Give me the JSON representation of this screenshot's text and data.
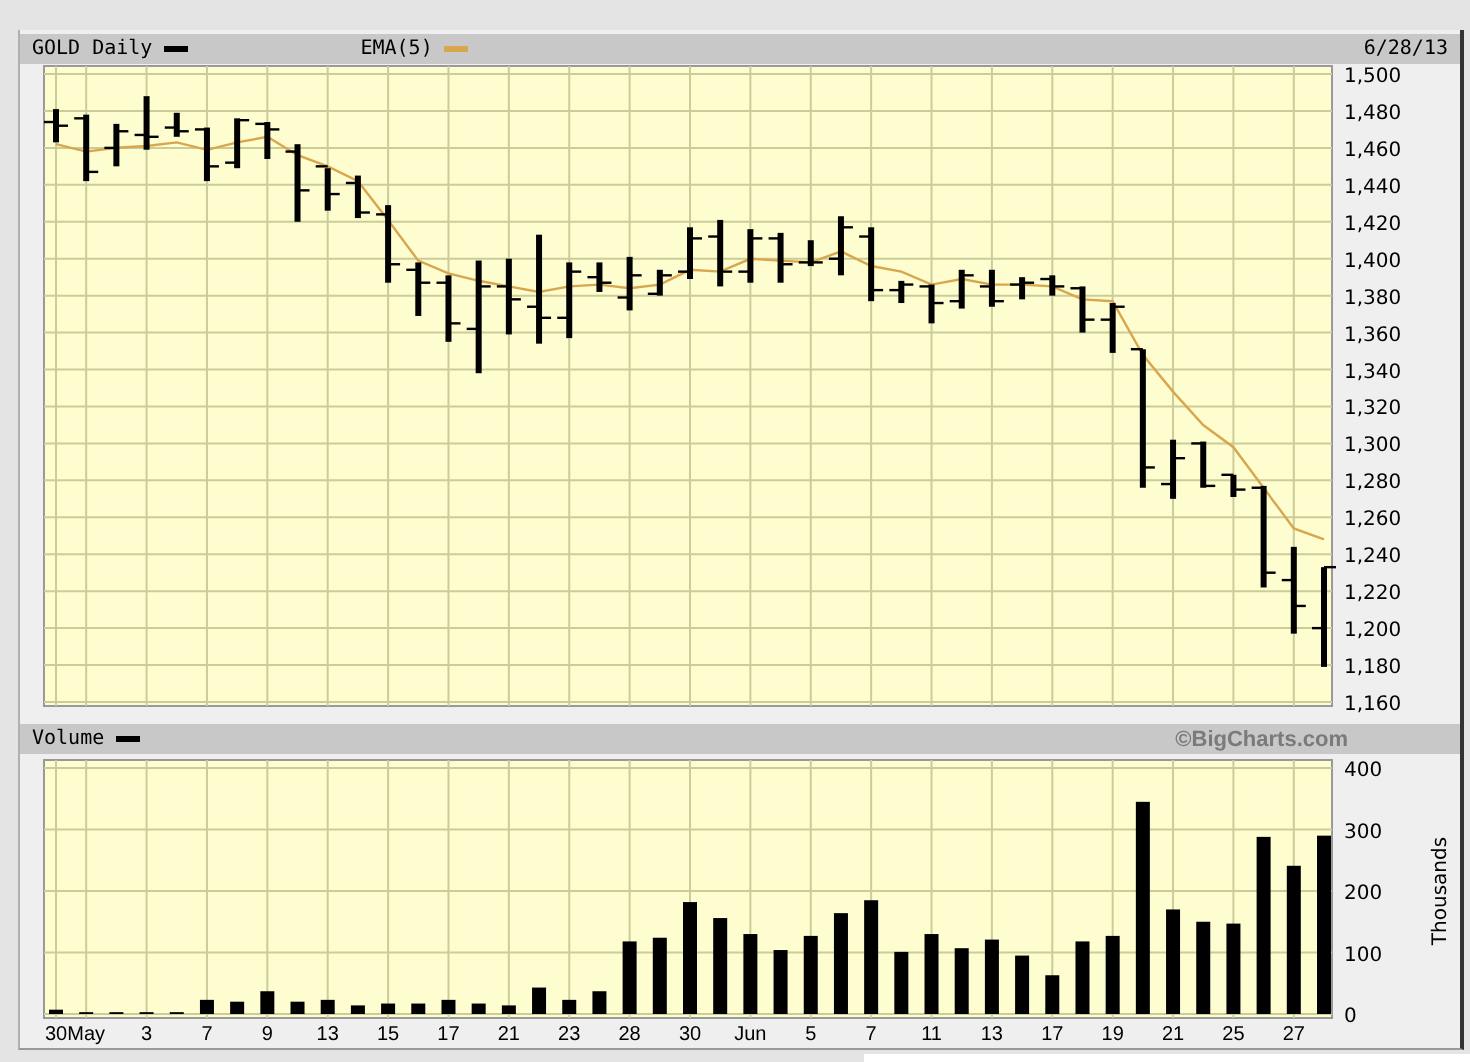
{
  "header": {
    "symbol": {
      "label": "GOLD Daily",
      "color": "#000000"
    },
    "date": "6/28/13"
  },
  "price_chart": {
    "chart_data": {
      "type": "line",
      "grid": true,
      "ylim": [
        1160,
        1500
      ],
      "yticks": [
        {
          "value": 1500,
          "label": "1,500"
        },
        {
          "value": 1480,
          "label": "1,480"
        },
        {
          "value": 1460,
          "label": "1,460"
        },
        {
          "value": 1440,
          "label": "1,440"
        },
        {
          "value": 1420,
          "label": "1,420"
        },
        {
          "value": 1400,
          "label": "1,400"
        },
        {
          "value": 1380,
          "label": "1,380"
        },
        {
          "value": 1360,
          "label": "1,360"
        },
        {
          "value": 1340,
          "label": "1,340"
        },
        {
          "value": 1320,
          "label": "1,320"
        },
        {
          "value": 1300,
          "label": "1,300"
        },
        {
          "value": 1280,
          "label": "1,280"
        },
        {
          "value": 1260,
          "label": "1,260"
        },
        {
          "value": 1240,
          "label": "1,240"
        },
        {
          "value": 1220,
          "label": "1,220"
        },
        {
          "value": 1200,
          "label": "1,200"
        },
        {
          "value": 1180,
          "label": "1,180"
        },
        {
          "value": 1160,
          "label": "1,160"
        }
      ],
      "series": [
        {
          "name": "EMA(5)",
          "color": "#d9a64e",
          "values": [
            1462,
            1458,
            1460,
            1461,
            1463,
            1459,
            1463,
            1466,
            1456,
            1450,
            1442,
            1421,
            1399,
            1392,
            1388,
            1385,
            1382,
            1385,
            1386,
            1384,
            1386,
            1394,
            1393,
            1400,
            1399,
            1398,
            1404,
            1396,
            1393,
            1386,
            1389,
            1386,
            1386,
            1385,
            1378,
            1377,
            1348,
            1328,
            1310,
            1298,
            1276,
            1254,
            1248
          ]
        }
      ]
    }
  },
  "volume_panel": {
    "credit": "©BigCharts.com",
    "chart_data": {
      "type": "bar",
      "grid": true,
      "ylabel": "Thousands",
      "ylim": [
        0,
        400
      ],
      "categories": [
        "30",
        "May",
        null,
        "3",
        null,
        "7",
        null,
        "9",
        null,
        "13",
        null,
        "15",
        null,
        "17",
        null,
        "21",
        null,
        "23",
        null,
        "28",
        null,
        "30",
        null,
        "Jun",
        null,
        "5",
        null,
        "7",
        null,
        "11",
        null,
        "13",
        null,
        "17",
        null,
        "19",
        null,
        "21",
        null,
        "25",
        null,
        "27",
        null
      ],
      "yticks": [
        {
          "value": 400,
          "label": "400"
        },
        {
          "value": 300,
          "label": "300"
        },
        {
          "value": 200,
          "label": "200"
        },
        {
          "value": 100,
          "label": "100"
        },
        {
          "value": 0,
          "label": "0"
        }
      ],
      "series": [
        {
          "name": "Volume",
          "color": "#000000",
          "values": [
            7,
            3,
            3,
            3,
            3,
            23,
            20,
            37,
            20,
            23,
            14,
            17,
            17,
            23,
            17,
            14,
            43,
            23,
            37,
            118,
            124,
            182,
            156,
            130,
            104,
            127,
            164,
            185,
            101,
            130,
            107,
            121,
            95,
            63,
            118,
            127,
            345,
            170,
            150,
            147,
            288,
            241,
            290
          ]
        }
      ]
    }
  }
}
